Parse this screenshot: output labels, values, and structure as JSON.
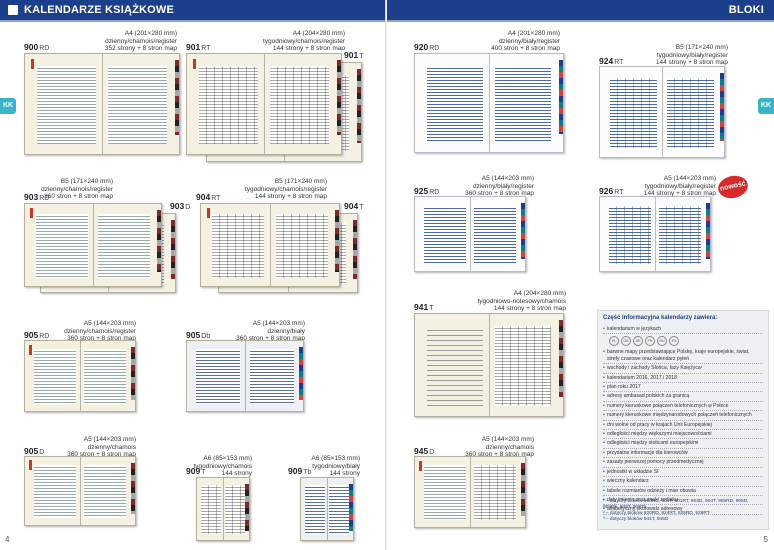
{
  "left": {
    "header": "KALENDARZE KSIĄŻKOWE",
    "side_tab": "KK",
    "page_number": "4",
    "products": [
      {
        "code": "900",
        "suffix": "RD",
        "spec": [
          "A4 (201×280 mm)",
          "dzienny/chamois/register",
          "352 strony + 8 stron map"
        ]
      },
      {
        "code": "901",
        "suffix": "RT",
        "spec": [
          "A4 (204×280 mm)",
          "tygodniowy/chamois/register",
          "144 strony + 8 stron map"
        ]
      },
      {
        "code": "901",
        "suffix": "T",
        "spec": []
      },
      {
        "code": "903",
        "suffix": "RD",
        "spec": [
          "B5 (171×240 mm)",
          "dzienny/chamois/register",
          "360 stron + 8 stron map"
        ]
      },
      {
        "code": "903",
        "suffix": "D",
        "spec": []
      },
      {
        "code": "904",
        "suffix": "RT",
        "spec": [
          "B5 (171×240 mm)",
          "tygodniowy/chamois/register",
          "144 strony + 8 stron map"
        ]
      },
      {
        "code": "904",
        "suffix": "T",
        "spec": []
      },
      {
        "code": "905",
        "suffix": "RD",
        "spec": [
          "A5 (144×203 mm)",
          "dzienny/chamois/register",
          "360 stron + 8 stron map"
        ]
      },
      {
        "code": "905",
        "suffix": "Db",
        "spec": [
          "A5 (144×203 mm)",
          "dzienny/biały",
          "360 stron + 8 stron map"
        ]
      },
      {
        "code": "905",
        "suffix": "D",
        "spec": [
          "A5 (144×203 mm)",
          "dzienny/chamois",
          "360 stron + 8 stron map"
        ]
      },
      {
        "code": "909",
        "suffix": "T",
        "spec": [
          "A6 (85×153 mm)",
          "tygodniowy/chamois",
          "144 strony"
        ]
      },
      {
        "code": "909",
        "suffix": "Tb",
        "spec": [
          "A6 (85×153 mm)",
          "tygodniowy/biały",
          "144 strony"
        ]
      }
    ]
  },
  "right": {
    "header": "BLOKI",
    "side_tab": "KK",
    "page_number": "5",
    "badge": "nowość",
    "products": [
      {
        "code": "920",
        "suffix": "RD",
        "spec": [
          "A4 (201×280 mm)",
          "dzienny/biały/register",
          "400 stron + 8 stron map"
        ]
      },
      {
        "code": "924",
        "suffix": "RT",
        "spec": [
          "B5 (171×240 mm)",
          "tygodniowy/biały/register",
          "144 strony + 8 stron map"
        ]
      },
      {
        "code": "925",
        "suffix": "RD",
        "spec": [
          "A5 (144×203 mm)",
          "dzienny/biały/register",
          "360 stron + 8 stron map"
        ]
      },
      {
        "code": "926",
        "suffix": "RT",
        "spec": [
          "A5 (144×203 mm)",
          "tygodniowy/biały/register",
          "144 strony + 8 stron map"
        ]
      },
      {
        "code": "941",
        "suffix": "T",
        "spec": [
          "A4 (204×280 mm)",
          "tygodniowo-notesowy/chamois",
          "144 strony + 8 stron map"
        ]
      },
      {
        "code": "945",
        "suffix": "D",
        "spec": [
          "A5 (144×203 mm)",
          "dzienny/chamois",
          "360 stron + 8 stron map"
        ]
      }
    ],
    "info": {
      "title": "Część informacyjna kalendarzy zawiera:",
      "items": [
        "kalendarium w językach",
        "barwne mapy przedstawiające Polskę, kraje europejskie, świat, strefy czasowe oraz kalendarz pyłeń",
        "wschody i zachody Słońca, fazy Księżyca¹",
        "kalendarium 2016, 2017 i 2018",
        "plan roku 2017",
        "adresy ambasad polskich za granicą",
        "numery kierunkowe połączeń telefonicznych w Polsce",
        "numery kierunkowe międzynarodowych połączeń telefonicznych",
        "dni wolne od pracy w krajach Unii Europejskiej",
        "odległości między większymi miejscowościami",
        "odległości między stolicami europejskimi",
        "przydatne informacje dla kierowców",
        "zasady pierwszej pomocy przedmedycznej",
        "jednostki w układzie SI",
        "wieczny kalendarz",
        "tabele rozmiarów odzieży i miar obuwia",
        "daty imienin oraz znaki zodiaku",
        "alfabetyczny skorowidz adresowy"
      ],
      "languages": [
        "PL",
        "GB",
        "DE",
        "FR",
        "RU",
        "ES"
      ],
      "footnotes": [
        "¹ – dotyczy bloków 900RD, 901T, 901RT, 903D, 904T, 905RD, 905D,",
        "905Db, 909T, 909Tb",
        "² – dotyczy bloków 920RD, 924RT, 925RD, 926RT",
        "³ – dotyczy bloków 941T, 945D"
      ]
    }
  }
}
